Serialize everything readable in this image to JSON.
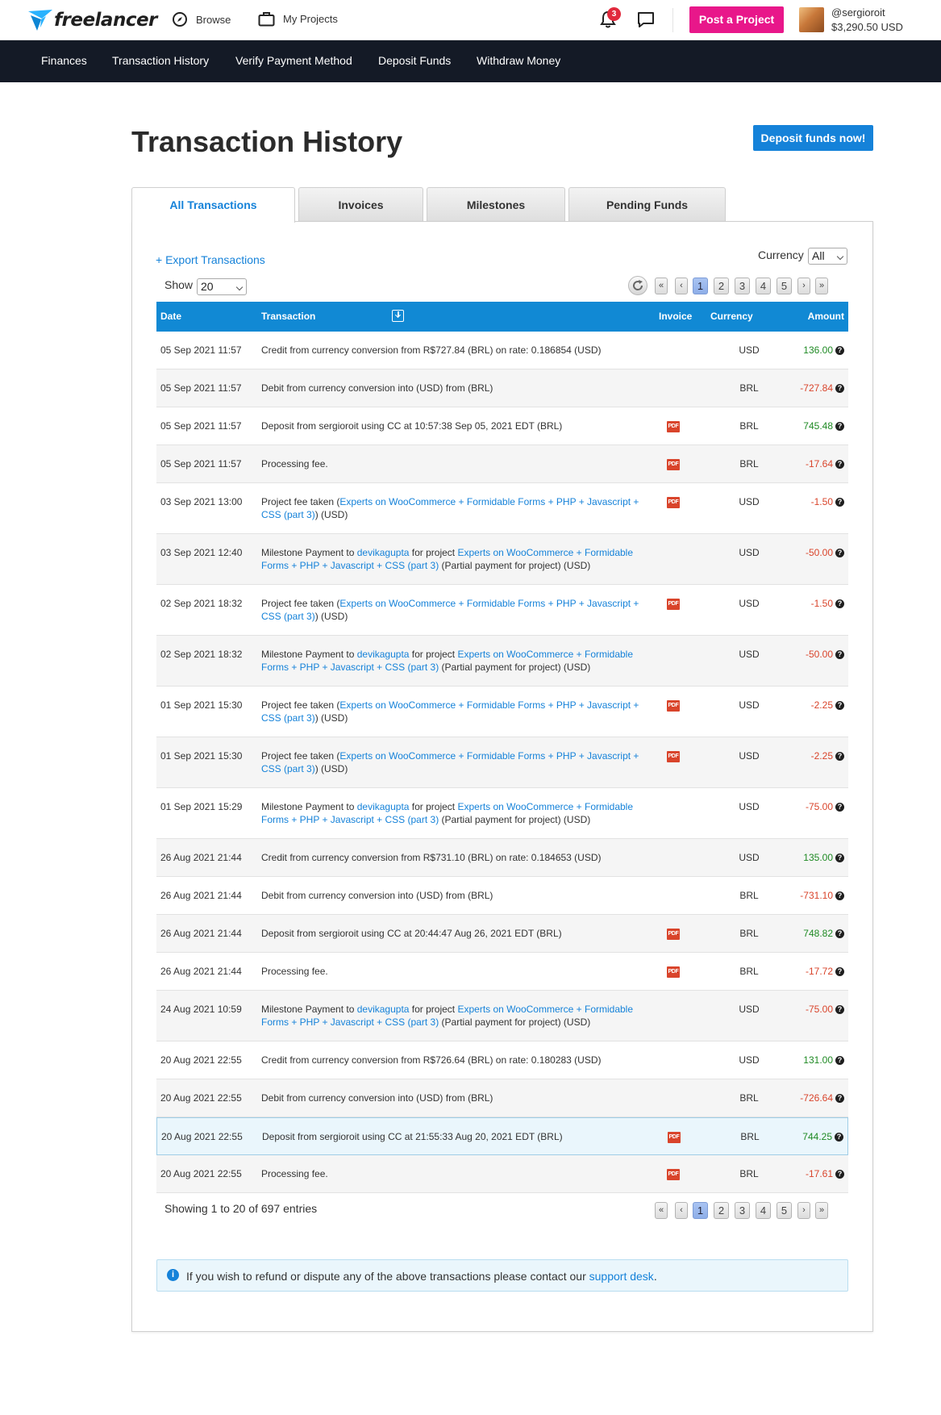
{
  "header": {
    "logo_text": "freelancer",
    "browse_label": "Browse",
    "my_projects_label": "My Projects",
    "notification_count": "3",
    "post_project_label": "Post a Project",
    "username": "@sergioroit",
    "balance": "$3,290.50 USD"
  },
  "subnav": {
    "items": [
      "Finances",
      "Transaction History",
      "Verify Payment Method",
      "Deposit Funds",
      "Withdraw Money"
    ]
  },
  "page": {
    "title": "Transaction History",
    "deposit_button": "Deposit funds now!"
  },
  "tabs": [
    "All Transactions",
    "Invoices",
    "Milestones",
    "Pending Funds"
  ],
  "controls": {
    "export_label": "+ Export Transactions",
    "currency_label": "Currency",
    "currency_value": "All",
    "show_label": "Show",
    "show_value": "20"
  },
  "pager": {
    "first": "«",
    "prev": "‹",
    "pages": [
      "1",
      "2",
      "3",
      "4",
      "5"
    ],
    "next": "›",
    "last": "»",
    "active_page": "1"
  },
  "table": {
    "columns": {
      "date": "Date",
      "transaction": "Transaction",
      "invoice": "Invoice",
      "currency": "Currency",
      "amount": "Amount"
    },
    "rows": [
      {
        "date": "05 Sep 2021 11:57",
        "desc": [
          {
            "t": "Credit from currency conversion from R$727.84 (BRL) on rate: 0.186854 (USD)"
          }
        ],
        "pdf": false,
        "currency": "USD",
        "amount": "136.00",
        "sign": "pos"
      },
      {
        "date": "05 Sep 2021 11:57",
        "desc": [
          {
            "t": "Debit from currency conversion into (USD) from (BRL)"
          }
        ],
        "pdf": false,
        "currency": "BRL",
        "amount": "-727.84",
        "sign": "neg"
      },
      {
        "date": "05 Sep 2021 11:57",
        "desc": [
          {
            "t": "Deposit from sergioroit using CC at 10:57:38 Sep 05, 2021 EDT (BRL)"
          }
        ],
        "pdf": true,
        "currency": "BRL",
        "amount": "745.48",
        "sign": "pos"
      },
      {
        "date": "05 Sep 2021 11:57",
        "desc": [
          {
            "t": "Processing fee."
          }
        ],
        "pdf": true,
        "currency": "BRL",
        "amount": "-17.64",
        "sign": "neg"
      },
      {
        "date": "03 Sep 2021 13:00",
        "desc": [
          {
            "t": "Project fee taken ("
          },
          {
            "t": "Experts on WooCommerce + Formidable Forms + PHP + Javascript + CSS (part 3)",
            "link": true
          },
          {
            "t": ") (USD)"
          }
        ],
        "pdf": true,
        "currency": "USD",
        "amount": "-1.50",
        "sign": "neg"
      },
      {
        "date": "03 Sep 2021 12:40",
        "desc": [
          {
            "t": "Milestone Payment to "
          },
          {
            "t": "devikagupta",
            "link": true
          },
          {
            "t": " for project "
          },
          {
            "t": "Experts on WooCommerce + Formidable Forms + PHP + Javascript + CSS (part 3)",
            "link": true
          },
          {
            "t": " (Partial payment for project) (USD)"
          }
        ],
        "pdf": false,
        "currency": "USD",
        "amount": "-50.00",
        "sign": "neg"
      },
      {
        "date": "02 Sep 2021 18:32",
        "desc": [
          {
            "t": "Project fee taken ("
          },
          {
            "t": "Experts on WooCommerce + Formidable Forms + PHP + Javascript + CSS (part 3)",
            "link": true
          },
          {
            "t": ") (USD)"
          }
        ],
        "pdf": true,
        "currency": "USD",
        "amount": "-1.50",
        "sign": "neg"
      },
      {
        "date": "02 Sep 2021 18:32",
        "desc": [
          {
            "t": "Milestone Payment to "
          },
          {
            "t": "devikagupta",
            "link": true
          },
          {
            "t": " for project "
          },
          {
            "t": "Experts on WooCommerce + Formidable Forms + PHP + Javascript + CSS (part 3)",
            "link": true
          },
          {
            "t": " (Partial payment for project) (USD)"
          }
        ],
        "pdf": false,
        "currency": "USD",
        "amount": "-50.00",
        "sign": "neg"
      },
      {
        "date": "01 Sep 2021 15:30",
        "desc": [
          {
            "t": "Project fee taken ("
          },
          {
            "t": "Experts on WooCommerce + Formidable Forms + PHP + Javascript + CSS (part 3)",
            "link": true
          },
          {
            "t": ") (USD)"
          }
        ],
        "pdf": true,
        "currency": "USD",
        "amount": "-2.25",
        "sign": "neg"
      },
      {
        "date": "01 Sep 2021 15:30",
        "desc": [
          {
            "t": "Project fee taken ("
          },
          {
            "t": "Experts on WooCommerce + Formidable Forms + PHP + Javascript + CSS (part 3)",
            "link": true
          },
          {
            "t": ") (USD)"
          }
        ],
        "pdf": true,
        "currency": "USD",
        "amount": "-2.25",
        "sign": "neg"
      },
      {
        "date": "01 Sep 2021 15:29",
        "desc": [
          {
            "t": "Milestone Payment to "
          },
          {
            "t": "devikagupta",
            "link": true
          },
          {
            "t": " for project "
          },
          {
            "t": "Experts on WooCommerce + Formidable Forms + PHP + Javascript + CSS (part 3)",
            "link": true
          },
          {
            "t": " (Partial payment for project) (USD)"
          }
        ],
        "pdf": false,
        "currency": "USD",
        "amount": "-75.00",
        "sign": "neg"
      },
      {
        "date": "26 Aug 2021 21:44",
        "desc": [
          {
            "t": "Credit from currency conversion from R$731.10 (BRL) on rate: 0.184653 (USD)"
          }
        ],
        "pdf": false,
        "currency": "USD",
        "amount": "135.00",
        "sign": "pos"
      },
      {
        "date": "26 Aug 2021 21:44",
        "desc": [
          {
            "t": "Debit from currency conversion into (USD) from (BRL)"
          }
        ],
        "pdf": false,
        "currency": "BRL",
        "amount": "-731.10",
        "sign": "neg"
      },
      {
        "date": "26 Aug 2021 21:44",
        "desc": [
          {
            "t": "Deposit from sergioroit using CC at 20:44:47 Aug 26, 2021 EDT (BRL)"
          }
        ],
        "pdf": true,
        "currency": "BRL",
        "amount": "748.82",
        "sign": "pos"
      },
      {
        "date": "26 Aug 2021 21:44",
        "desc": [
          {
            "t": "Processing fee."
          }
        ],
        "pdf": true,
        "currency": "BRL",
        "amount": "-17.72",
        "sign": "neg"
      },
      {
        "date": "24 Aug 2021 10:59",
        "desc": [
          {
            "t": "Milestone Payment to "
          },
          {
            "t": "devikagupta",
            "link": true
          },
          {
            "t": " for project "
          },
          {
            "t": "Experts on WooCommerce + Formidable Forms + PHP + Javascript + CSS (part 3)",
            "link": true
          },
          {
            "t": " (Partial payment for project) (USD)"
          }
        ],
        "pdf": false,
        "currency": "USD",
        "amount": "-75.00",
        "sign": "neg"
      },
      {
        "date": "20 Aug 2021 22:55",
        "desc": [
          {
            "t": "Credit from currency conversion from R$726.64 (BRL) on rate: 0.180283 (USD)"
          }
        ],
        "pdf": false,
        "currency": "USD",
        "amount": "131.00",
        "sign": "pos"
      },
      {
        "date": "20 Aug 2021 22:55",
        "desc": [
          {
            "t": "Debit from currency conversion into (USD) from (BRL)"
          }
        ],
        "pdf": false,
        "currency": "BRL",
        "amount": "-726.64",
        "sign": "neg"
      },
      {
        "date": "20 Aug 2021 22:55",
        "desc": [
          {
            "t": "Deposit from sergioroit using CC at 21:55:33 Aug 20, 2021 EDT (BRL)"
          }
        ],
        "pdf": true,
        "currency": "BRL",
        "amount": "744.25",
        "sign": "pos",
        "highlight": true
      },
      {
        "date": "20 Aug 2021 22:55",
        "desc": [
          {
            "t": "Processing fee."
          }
        ],
        "pdf": true,
        "currency": "BRL",
        "amount": "-17.61",
        "sign": "neg"
      }
    ],
    "pdf_label": "PDF",
    "info_glyph": "?"
  },
  "footer": {
    "showing_text": "Showing 1 to 20 of 697 entries",
    "info_text": "If you wish to refund or dispute any of the above transactions please contact our ",
    "info_link": "support desk",
    "info_end": "."
  },
  "colors": {
    "brand_blue": "#1582d9",
    "post_pink": "#e8178a",
    "subnav_dark": "#141a26",
    "table_header": "#1189d4",
    "positive": "#1f8a24",
    "negative": "#d9442b"
  }
}
